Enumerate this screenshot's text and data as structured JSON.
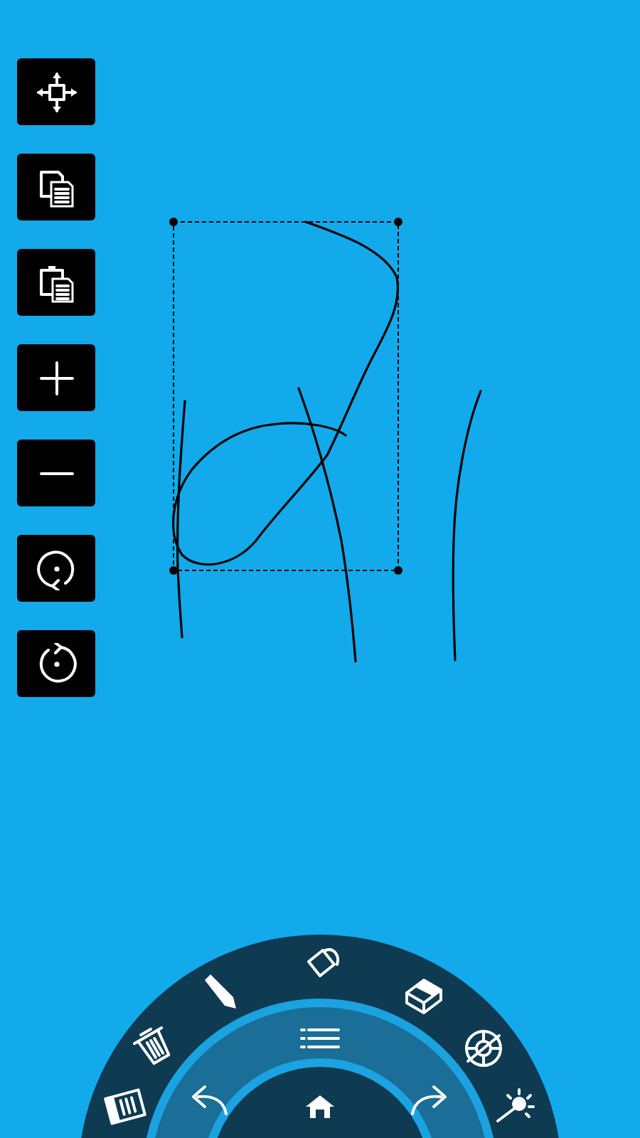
{
  "toolbar": [
    {
      "kind": "move"
    },
    {
      "kind": "copy"
    },
    {
      "kind": "paste"
    },
    {
      "kind": "zoom-in"
    },
    {
      "kind": "zoom-out"
    },
    {
      "kind": "rotate-cw"
    },
    {
      "kind": "rotate-ccw"
    }
  ],
  "canvas": {
    "selection_visible": true
  },
  "radial_menu": {
    "outer": [
      {
        "kind": "document"
      },
      {
        "kind": "trash"
      },
      {
        "kind": "pencil"
      },
      {
        "kind": "bucket"
      },
      {
        "kind": "eraser"
      },
      {
        "kind": "disc"
      },
      {
        "kind": "light"
      }
    ],
    "inner": [
      {
        "kind": "undo"
      },
      {
        "kind": "menu"
      },
      {
        "kind": "redo"
      }
    ],
    "center": {
      "kind": "home"
    }
  }
}
